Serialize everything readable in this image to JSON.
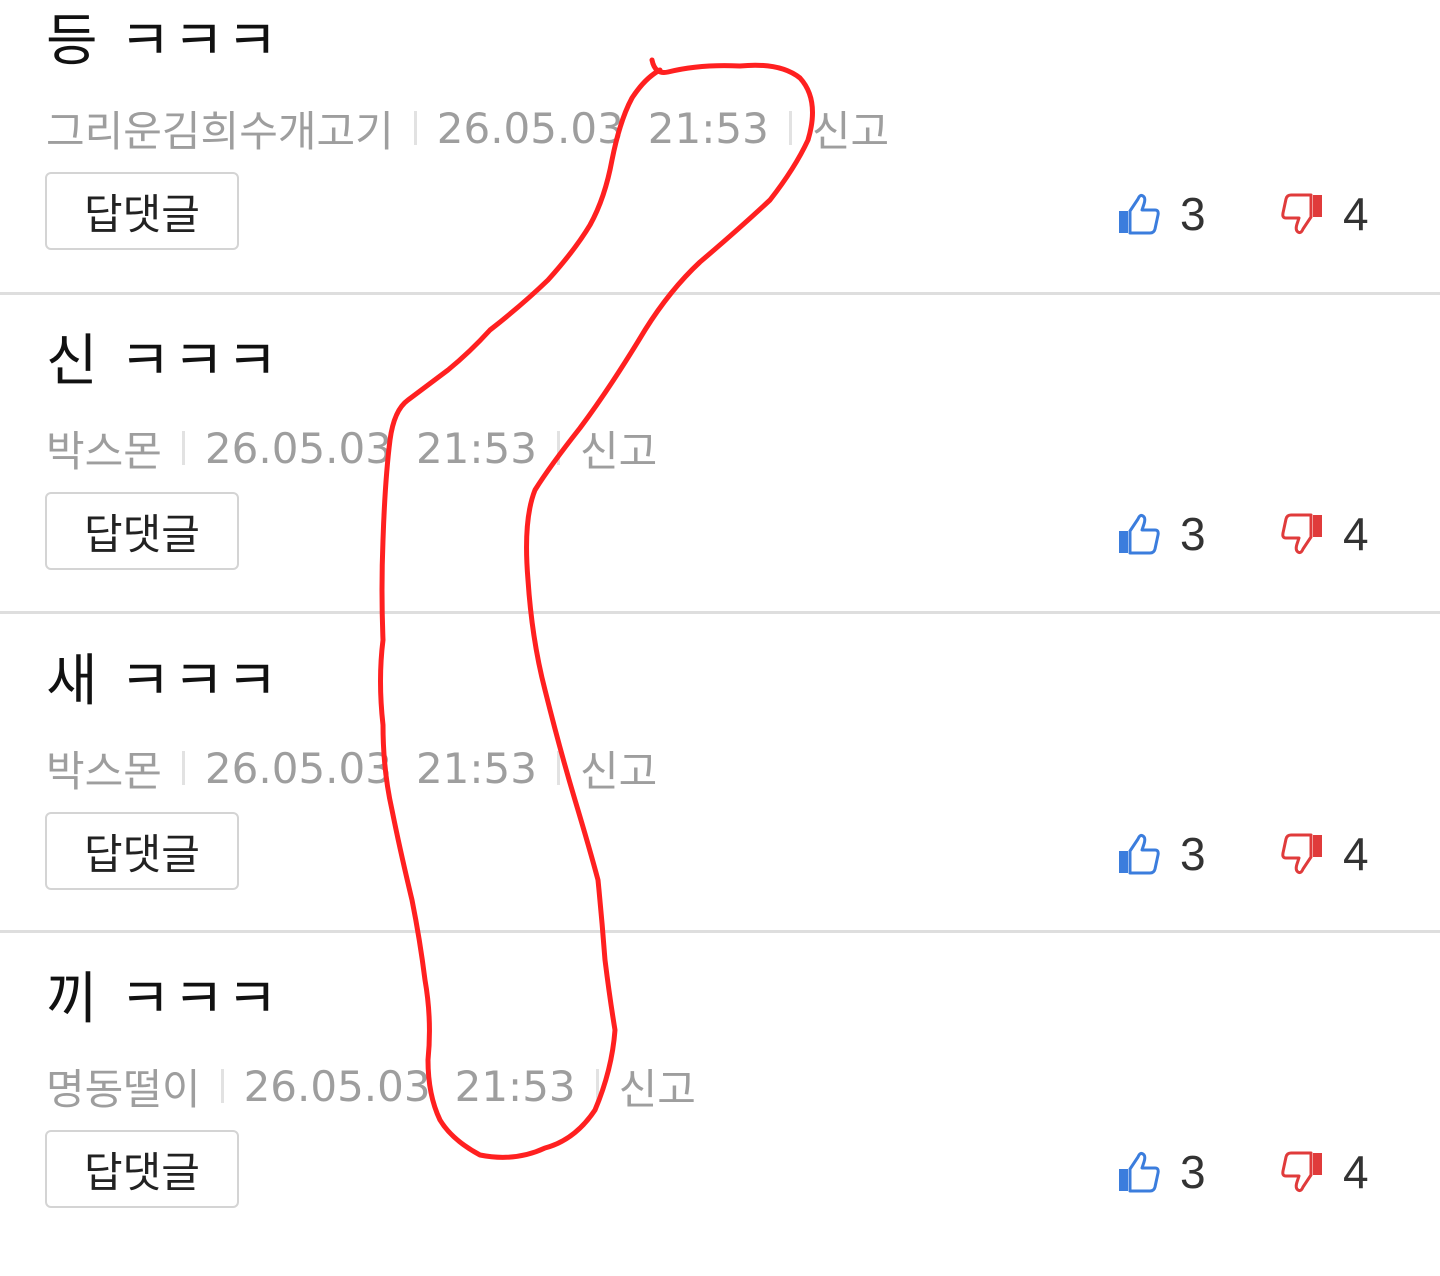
{
  "comments": [
    {
      "text": "등 ㅋㅋㅋ",
      "author": "그리운김희수개고기",
      "date": "26.05.03",
      "time": "21:53",
      "report_label": "신고",
      "reply_label": "답댓글",
      "likes": "3",
      "dislikes": "4"
    },
    {
      "text": "신 ㅋㅋㅋ",
      "author": "박스몬",
      "date": "26.05.03",
      "time": "21:53",
      "report_label": "신고",
      "reply_label": "답댓글",
      "likes": "3",
      "dislikes": "4"
    },
    {
      "text": "새 ㅋㅋㅋ",
      "author": "박스몬",
      "date": "26.05.03",
      "time": "21:53",
      "report_label": "신고",
      "reply_label": "답댓글",
      "likes": "3",
      "dislikes": "4"
    },
    {
      "text": "끼 ㅋㅋㅋ",
      "author": "명동떨이",
      "date": "26.05.03",
      "time": "21:53",
      "report_label": "신고",
      "reply_label": "답댓글",
      "likes": "3",
      "dislikes": "4"
    }
  ],
  "icons": {
    "like": "thumbs-up-icon",
    "dislike": "thumbs-down-icon"
  },
  "colors": {
    "like": "#3b7ddd",
    "dislike": "#e03b3b",
    "annotation": "#ff2020",
    "meta_text": "#9e9e9e"
  }
}
